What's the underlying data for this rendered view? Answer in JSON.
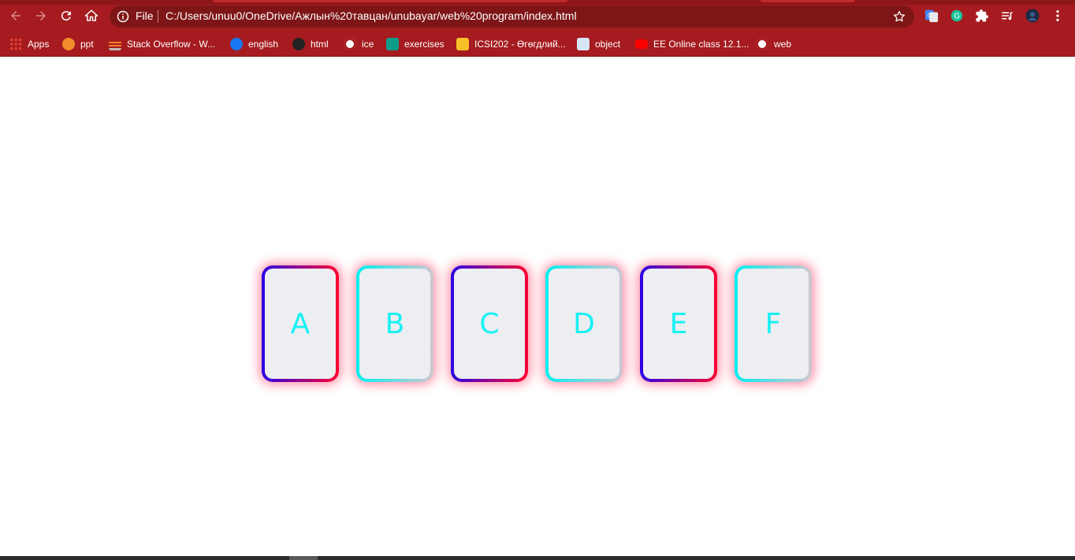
{
  "browser": {
    "address": {
      "scheme_label": "File",
      "url": "C:/Users/unuu0/OneDrive/Ажлын%20тавцан/unubayar/web%20program/index.html"
    },
    "bookmarks": [
      {
        "label": "Apps",
        "icon": "apps-grid-icon",
        "color": "#f4b400"
      },
      {
        "label": "ppt",
        "icon": "ppt-icon",
        "color": "#f28b2a"
      },
      {
        "label": "Stack Overflow - W...",
        "icon": "stackoverflow-icon",
        "color": "#f48024"
      },
      {
        "label": "english",
        "icon": "facebook-icon",
        "color": "#1877f2"
      },
      {
        "label": "html",
        "icon": "html-icon",
        "color": "#222222"
      },
      {
        "label": "ice",
        "icon": "github-icon",
        "color": "#ffffff"
      },
      {
        "label": "exercises",
        "icon": "exercises-icon",
        "color": "#0f9d8a"
      },
      {
        "label": "ICSI202 - Өгөгдлий...",
        "icon": "classroom-icon",
        "color": "#f6c026"
      },
      {
        "label": "object",
        "icon": "object-icon",
        "color": "#4a90d9"
      },
      {
        "label": "EE Online class 12.1...",
        "icon": "youtube-icon",
        "color": "#ff0000"
      },
      {
        "label": "web",
        "icon": "github-icon",
        "color": "#ffffff"
      }
    ]
  },
  "page": {
    "cards": [
      {
        "letter": "A",
        "style": "purple"
      },
      {
        "letter": "B",
        "style": "cyan"
      },
      {
        "letter": "C",
        "style": "purple"
      },
      {
        "letter": "D",
        "style": "cyan"
      },
      {
        "letter": "E",
        "style": "purple"
      },
      {
        "letter": "F",
        "style": "cyan"
      }
    ],
    "colors": {
      "letter": "#17f1f3",
      "purple_border_start": "#2a00e6",
      "purple_border_end": "#ff0030",
      "cyan_border_start": "#00f0f0",
      "glow": "#ff0032",
      "toolbar": "#a51b1f"
    }
  }
}
